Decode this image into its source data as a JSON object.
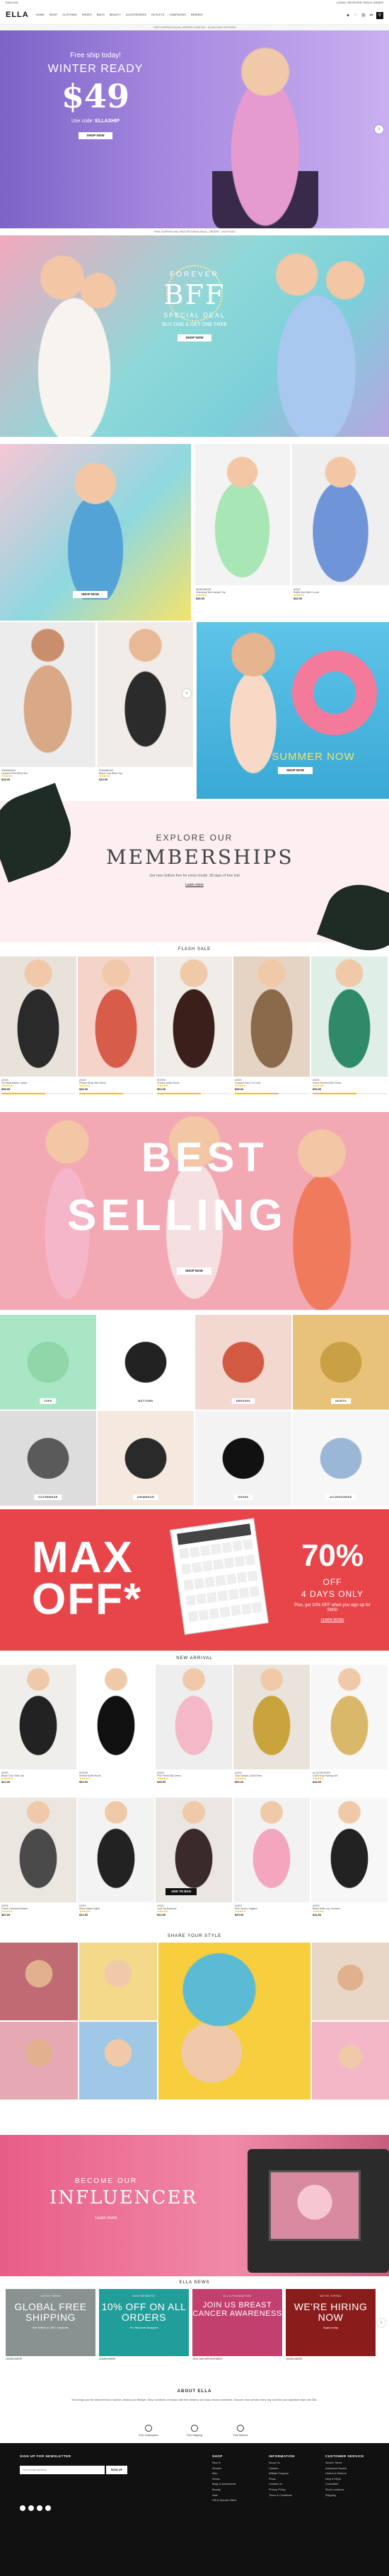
{
  "topbar": {
    "left": "ENGLISH",
    "right": "LOGIN / REGISTER   TRACK ORDER"
  },
  "header": {
    "logo": "ELLA",
    "nav": [
      "HOME",
      "SHOP",
      "CLOTHING",
      "SHOES",
      "BAGS",
      "BEAUTY",
      "ACCESSORIES",
      "OUTLETS",
      "CAMPAIGNS",
      "BRANDS"
    ],
    "icons": [
      "user-icon",
      "heart-icon",
      "bag-icon",
      "compare-icon"
    ],
    "search_icon": "search-icon"
  },
  "subnav_text": "FREE SHIPPING ON ALL ORDERS OVER $75   ·   30-DAY EASY RETURNS",
  "hero1": {
    "line1": "Free ship today!",
    "line2": "WINTER READY",
    "price": "$49",
    "code_label": "Use code:",
    "code": "ELLASHIP",
    "button": "SHOP NOW"
  },
  "info_strip": "FREE SHIPPING AND FREE RETURNS ON ALL ORDERS  ·  SHOP NOW",
  "hero2": {
    "line1": "FOREVER",
    "line2": "BFF",
    "line3": "SPECIAL DEAL",
    "line4": "BUY ONE & GET ONE FREE",
    "button": "SHOP NOW"
  },
  "grid1": {
    "banner_button": "SHOP NOW",
    "products": [
      {
        "brand": "WORKWEAR",
        "name": "Oversized Knit Jumper Top",
        "price": "$36.00"
      },
      {
        "brand": "ASOS",
        "name": "Ruffle Mini Skirt Co-ord",
        "price": "$42.00"
      }
    ]
  },
  "grid2": {
    "products": [
      {
        "brand": "SWIMWEAR",
        "name": "Leopard Print Bikini Set",
        "price": "$28.00"
      },
      {
        "brand": "SWIMWEAR",
        "name": "Black Crop Bikini Top",
        "price": "$24.00"
      }
    ],
    "banner_title": "SUMMER NOW",
    "banner_button": "SHOP NOW"
  },
  "memberships": {
    "line1": "EXPLORE OUR",
    "line2": "MEMBERSHIPS",
    "text": "Get new clothes free for every month. 30 days of free trial",
    "link": "Learn more"
  },
  "flash_sale": {
    "title": "FLASH SALE",
    "products": [
      {
        "brand": "ASOS",
        "name": "Tie Waist Blazer Jacket",
        "price": "$58.00"
      },
      {
        "brand": "ASOS",
        "name": "Printed Wrap Midi Dress",
        "price": "$46.00"
      },
      {
        "brand": "SHOES",
        "name": "Chunky Ankle Boots",
        "price": "$64.00"
      },
      {
        "brand": "ASOS",
        "name": "Leopard Faux Fur Coat",
        "price": "$89.00"
      },
      {
        "brand": "ASOS",
        "name": "Green Ruched Mini Dress",
        "price": "$39.00"
      }
    ]
  },
  "best_selling": {
    "line1": "BEST",
    "line2": "SELLING",
    "button": "SHOP NOW"
  },
  "categories": [
    "TOPS",
    "BOTTOMS",
    "DRESSES",
    "SKIRTS",
    "OUTERWEAR",
    "SWIMWEAR",
    "SHOES",
    "ACCESSORIES"
  ],
  "max_off": {
    "left": "MAX OFF*",
    "percent": "70%",
    "off": "OFF",
    "days": "4 DAYS ONLY",
    "small": "Plus, get 10% OFF when you sign up for SMS!",
    "link": "LEARN MORE"
  },
  "new_arrival": {
    "title": "NEW ARRIVAL",
    "products": [
      {
        "brand": "ASOS",
        "name": "Black Crop Tank Top",
        "price": "$22.00"
      },
      {
        "brand": "SHOES",
        "name": "Heeled Ankle Boots",
        "price": "$54.00"
      },
      {
        "brand": "ASOS",
        "name": "Pink Floral Slip Dress",
        "price": "$48.00"
      },
      {
        "brand": "ASOS",
        "name": "Gold Sequin Cami Dress",
        "price": "$52.00"
      },
      {
        "brand": "ACCESSORIES",
        "name": "Gold Hoop Earring Set",
        "price": "$18.00"
      },
      {
        "brand": "ASOS",
        "name": "Check Oversized Blazer",
        "price": "$62.00"
      },
      {
        "brand": "ASOS",
        "name": "Sheer Black Tights",
        "price": "$12.00"
      },
      {
        "brand": "ASOS",
        "name": "Lace Up Bodysuit",
        "price": "$34.00"
      },
      {
        "brand": "ASOS",
        "name": "Pink Jersey Joggers",
        "price": "$29.00"
      },
      {
        "brand": "ASOS",
        "name": "Black Wide Leg Trousers",
        "price": "$44.00"
      }
    ],
    "hover_button": "ADD TO BAG"
  },
  "share_style": {
    "title": "SHARE YOUR STYLE"
  },
  "influencer": {
    "line1": "BECOME OUR",
    "line2": "INFLUENCER",
    "link": "Learn more"
  },
  "news": {
    "title": "ELLA NEWS",
    "cards": [
      {
        "kicker": "LATEST NEWS",
        "headline": "GLOBAL FREE SHIPPING",
        "sub": "We deliver to 200+ countries",
        "color": "#7f8c8d"
      },
      {
        "kicker": "NEW MEMBERS",
        "headline": "10% OFF ON ALL ORDERS",
        "sub": "For first-time shoppers",
        "color": "#1f9c98"
      },
      {
        "kicker": "ELLA FOUNDATION",
        "headline": "JOIN US BREAST CANCER AWARENESS",
        "sub": "",
        "color": "#c0396b"
      },
      {
        "kicker": "WE'RE HIRING",
        "headline": "WE'RE HIRING NOW",
        "sub": "Apply today",
        "color": "#8b1a1a"
      }
    ],
    "meta": [
      "LEARN MORE",
      "LEARN MORE",
      "JOIN OUR APPOINTMENT",
      "LEARN MORE"
    ]
  },
  "about": {
    "title": "ABOUT ELLA",
    "text": "Ella brings you the latest trends in fashion, beauty and lifestyle. Shop hundreds of brands with free delivery and easy returns worldwide. Discover new arrivals every day and find your signature style with Ella."
  },
  "features": [
    {
      "label": "Free Subscription",
      "icon": "gift-icon"
    },
    {
      "label": "Free Shipping",
      "icon": "truck-icon"
    },
    {
      "label": "Free Returns",
      "icon": "return-icon"
    }
  ],
  "footer": {
    "newsletter_title": "SIGN UP FOR NEWSLETTER",
    "email_placeholder": "Your email address",
    "subscribe": "SIGN UP",
    "col1": {
      "title": "SHOP",
      "items": [
        "New In",
        "Women",
        "Men",
        "Shoes",
        "Bags & Accessories",
        "Beauty",
        "Sale",
        "Gift & Special Offers"
      ]
    },
    "col2": {
      "title": "INFORMATION",
      "items": [
        "About Us",
        "Careers",
        "Affiliate Program",
        "Press",
        "Contact Us",
        "Privacy Policy",
        "Terms & Conditions"
      ]
    },
    "col3": {
      "title": "CUSTOMER SERVICE",
      "items": [
        "Search Terms",
        "Advanced Search",
        "Orders & Returns",
        "Help & FAQs",
        "Consultant",
        "Store Locations",
        "Shipping"
      ]
    }
  }
}
